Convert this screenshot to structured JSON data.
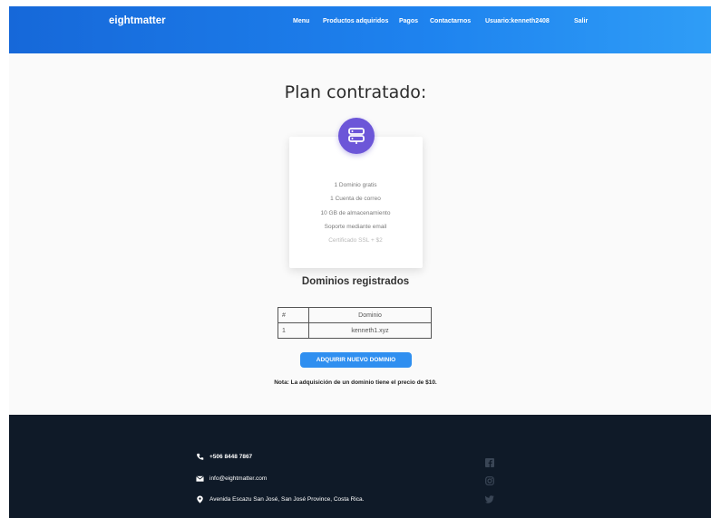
{
  "header": {
    "brand": "eightmatter",
    "nav": [
      "Menu",
      "Productos adquiridos",
      "Pagos",
      "Contactarnos",
      "Usuario:kenneth2408",
      "Salir"
    ]
  },
  "plan": {
    "title": "Plan contratado:",
    "icon": "server-icon",
    "features": [
      "1 Dominio gratis",
      "1 Cuenta de correo",
      "10 GB de almacenamiento",
      "Soporte mediante email",
      "Certificado SSL + $2"
    ]
  },
  "domains": {
    "title": "Dominios registrados",
    "headers": [
      "#",
      "Dominio"
    ],
    "rows": [
      [
        "1",
        "kenneth1.xyz"
      ]
    ]
  },
  "actions": {
    "buy_label": "ADQUIRIR NUEVO DOMINIO",
    "note": "Nota: La adquisición de un dominio tiene el precio de $10."
  },
  "footer": {
    "phone": "+506 8448 7867",
    "email": "info@eightmatter.com",
    "address": "Avenida Escazu San José, San José Province, Costa Rica.",
    "social": [
      "facebook-icon",
      "instagram-icon",
      "twitter-icon"
    ]
  },
  "colors": {
    "header_start": "#1668d9",
    "header_end": "#2f9df6",
    "accent": "#2f8ff0",
    "icon_purple": "#6c56d8",
    "footer_bg": "#0f1a28"
  }
}
